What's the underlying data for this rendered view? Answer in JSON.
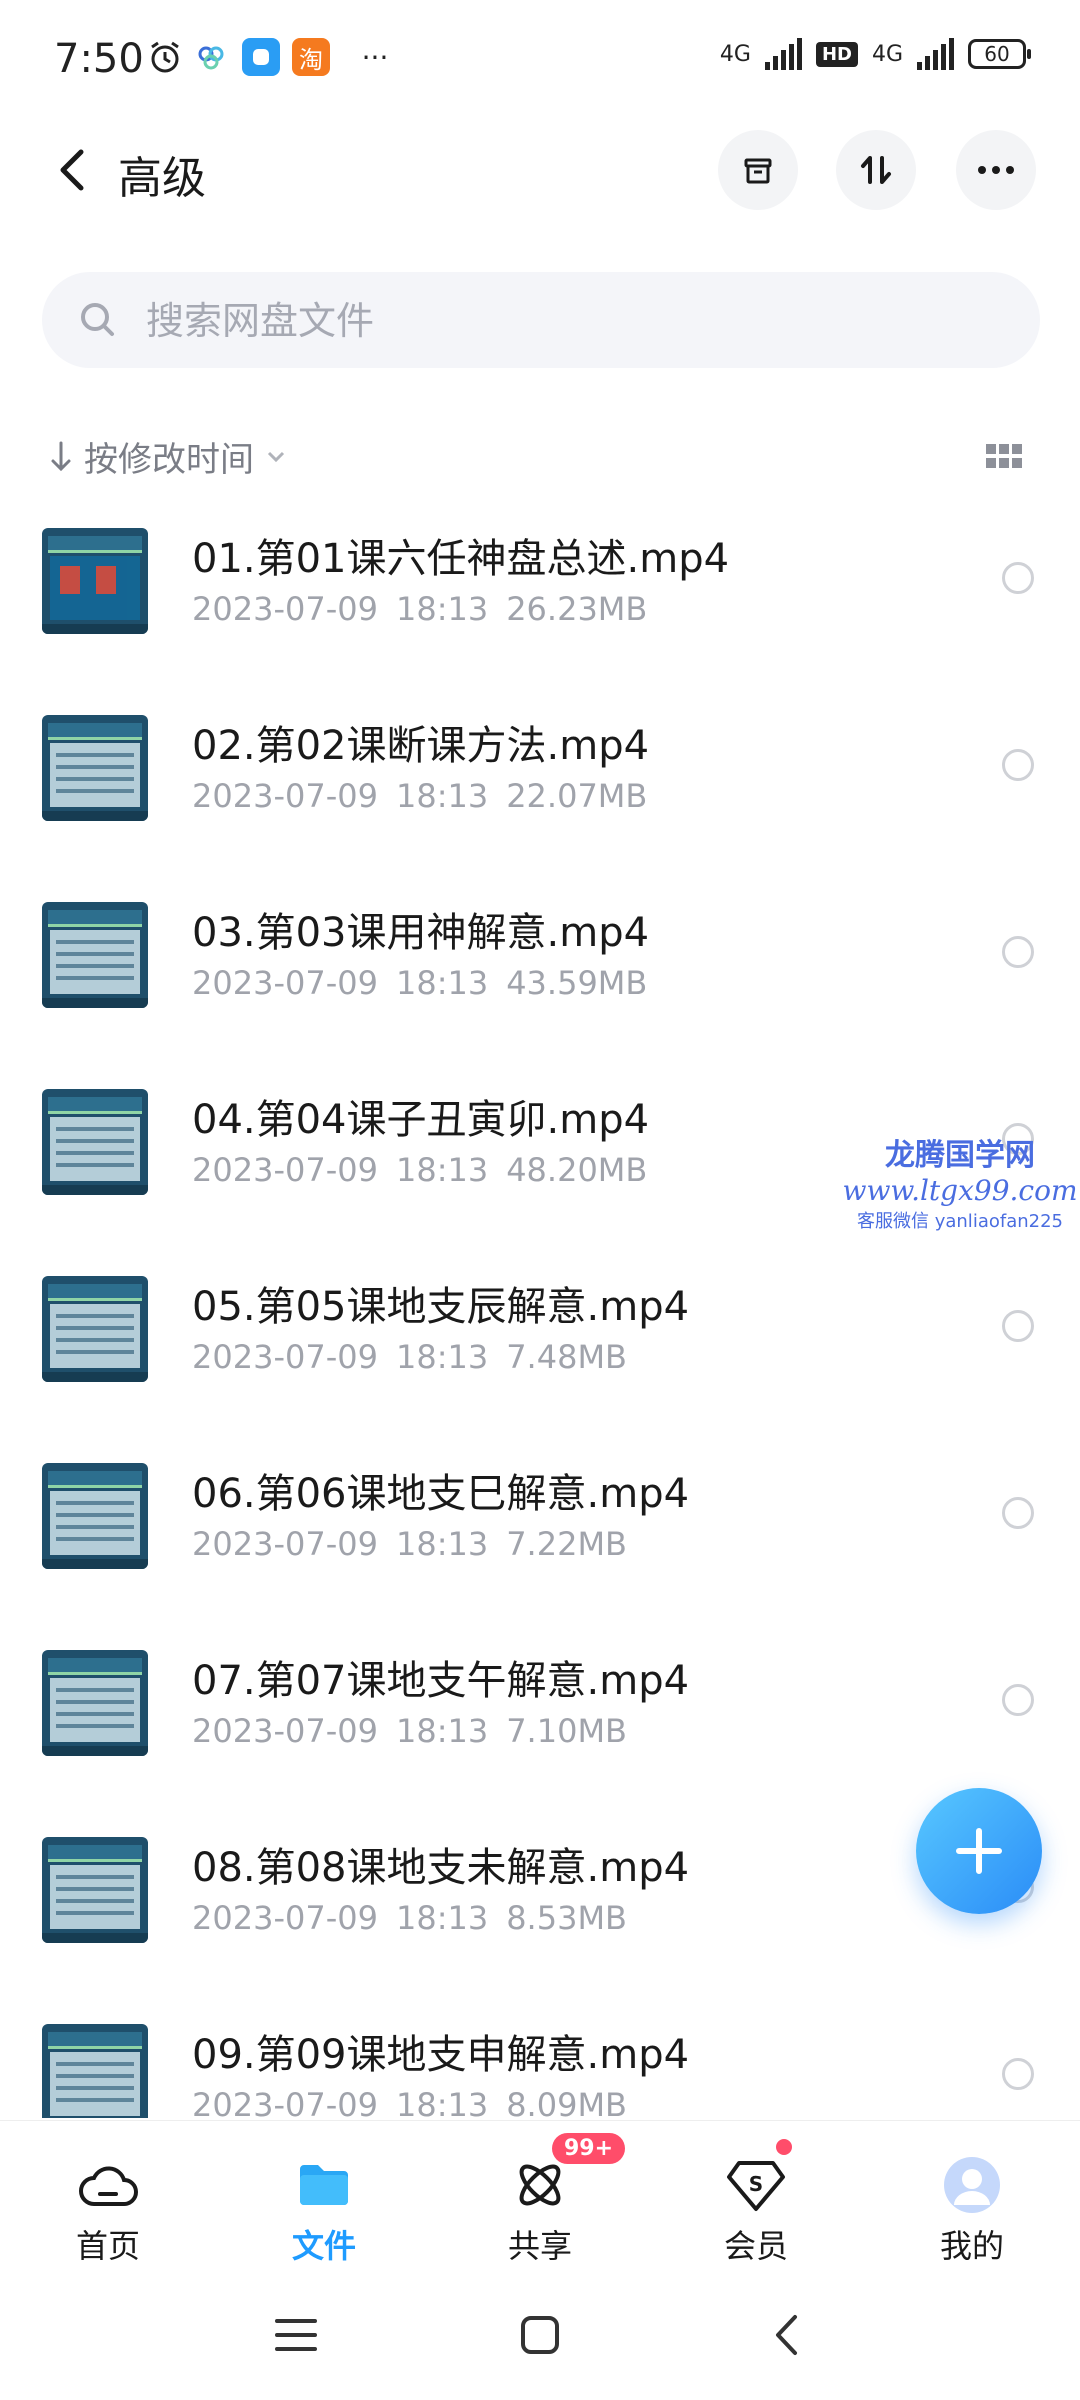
{
  "status_bar": {
    "time": "7:50",
    "taobao_label": "淘",
    "more": "···",
    "net1": "4G",
    "hd": "HD",
    "net2": "4G",
    "battery": "60"
  },
  "header": {
    "title": "高级"
  },
  "search": {
    "placeholder": "搜索网盘文件"
  },
  "sort": {
    "label": "按修改时间"
  },
  "files": [
    {
      "name": "01.第01课六任神盘总述.mp4",
      "date": "2023-07-09",
      "time": "18:13",
      "size": "26.23MB"
    },
    {
      "name": "02.第02课断课方法.mp4",
      "date": "2023-07-09",
      "time": "18:13",
      "size": "22.07MB"
    },
    {
      "name": "03.第03课用神解意.mp4",
      "date": "2023-07-09",
      "time": "18:13",
      "size": "43.59MB"
    },
    {
      "name": "04.第04课子丑寅卯.mp4",
      "date": "2023-07-09",
      "time": "18:13",
      "size": "48.20MB"
    },
    {
      "name": "05.第05课地支辰解意.mp4",
      "date": "2023-07-09",
      "time": "18:13",
      "size": "7.48MB"
    },
    {
      "name": "06.第06课地支巳解意.mp4",
      "date": "2023-07-09",
      "time": "18:13",
      "size": "7.22MB"
    },
    {
      "name": "07.第07课地支午解意.mp4",
      "date": "2023-07-09",
      "time": "18:13",
      "size": "7.10MB"
    },
    {
      "name": "08.第08课地支未解意.mp4",
      "date": "2023-07-09",
      "time": "18:13",
      "size": "8.53MB"
    },
    {
      "name": "09.第09课地支申解意.mp4",
      "date": "2023-07-09",
      "time": "18:13",
      "size": "8.09MB"
    }
  ],
  "watermark": {
    "line1": "龙腾国学网",
    "line2": "www.ltgx99.com",
    "line3": "客服微信 yanliaofan225"
  },
  "bottom_nav": {
    "items": [
      {
        "label": "首页",
        "icon": "cloud-home-icon"
      },
      {
        "label": "文件",
        "icon": "folder-icon"
      },
      {
        "label": "共享",
        "icon": "share-atom-icon"
      },
      {
        "label": "会员",
        "icon": "vip-diamond-icon"
      },
      {
        "label": "我的",
        "icon": "avatar-icon"
      }
    ],
    "share_badge": "99+"
  },
  "colors": {
    "accent": "#1e9bff",
    "badge": "#ff4d6a",
    "fab_start": "#58c8ff",
    "fab_end": "#2a8cf7"
  }
}
